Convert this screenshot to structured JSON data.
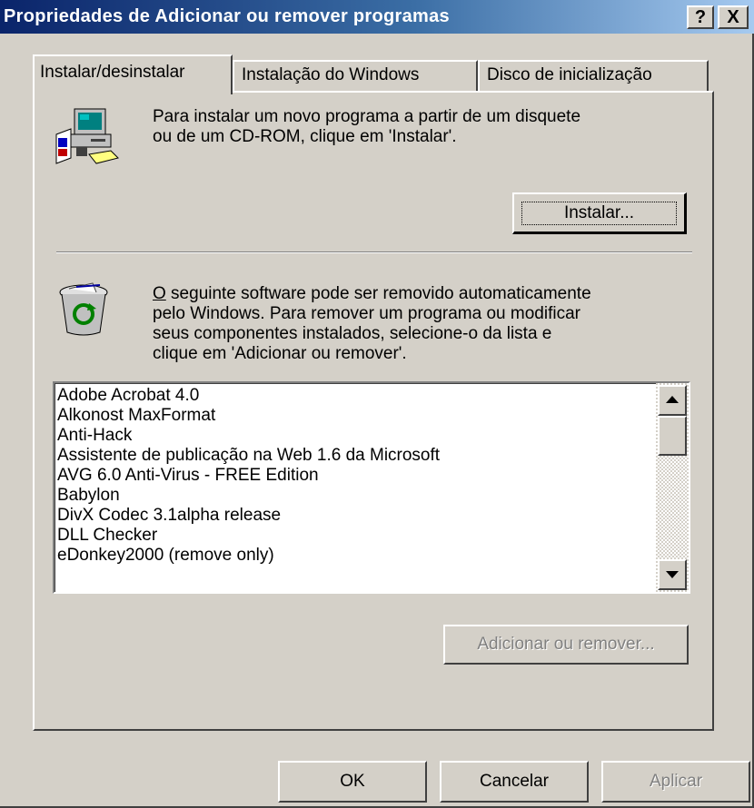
{
  "window": {
    "title": "Propriedades de Adicionar ou remover programas",
    "help_label": "?",
    "close_label": "X"
  },
  "tabs": [
    {
      "label": "Instalar/desinstalar",
      "active": true
    },
    {
      "label": "Instalação do Windows",
      "active": false
    },
    {
      "label": "Disco de inicialização",
      "active": false
    }
  ],
  "install": {
    "description_line1": "Para instalar um novo programa a partir de um disquete",
    "description_line2": "ou de um CD-ROM, clique em 'Instalar'.",
    "button_label": "Instalar...",
    "icon": "computer-install-icon"
  },
  "remove": {
    "mnemonic": "O",
    "description_line1_rest": " seguinte software pode ser removido automaticamente",
    "description_line2": "pelo Windows. Para remover um programa ou modificar",
    "description_line3": "seus componentes instalados, selecione-o da lista e",
    "description_line4": "clique em 'Adicionar ou remover'.",
    "icon": "recycle-bin-icon",
    "button_label": "Adicionar ou remover..."
  },
  "programs": [
    "Adobe Acrobat 4.0",
    "Alkonost MaxFormat",
    "Anti-Hack",
    "Assistente de publicação na Web 1.6 da Microsoft",
    "AVG 6.0 Anti-Virus - FREE Edition",
    "Babylon",
    "DivX Codec 3.1alpha release",
    "DLL Checker",
    "eDonkey2000 (remove only)"
  ],
  "footer": {
    "ok_label": "OK",
    "cancel_label": "Cancelar",
    "apply_label": "Aplicar"
  },
  "colors": {
    "titlebar_start": "#0a246a",
    "titlebar_end": "#a6caf0",
    "face": "#d4d0c8"
  }
}
